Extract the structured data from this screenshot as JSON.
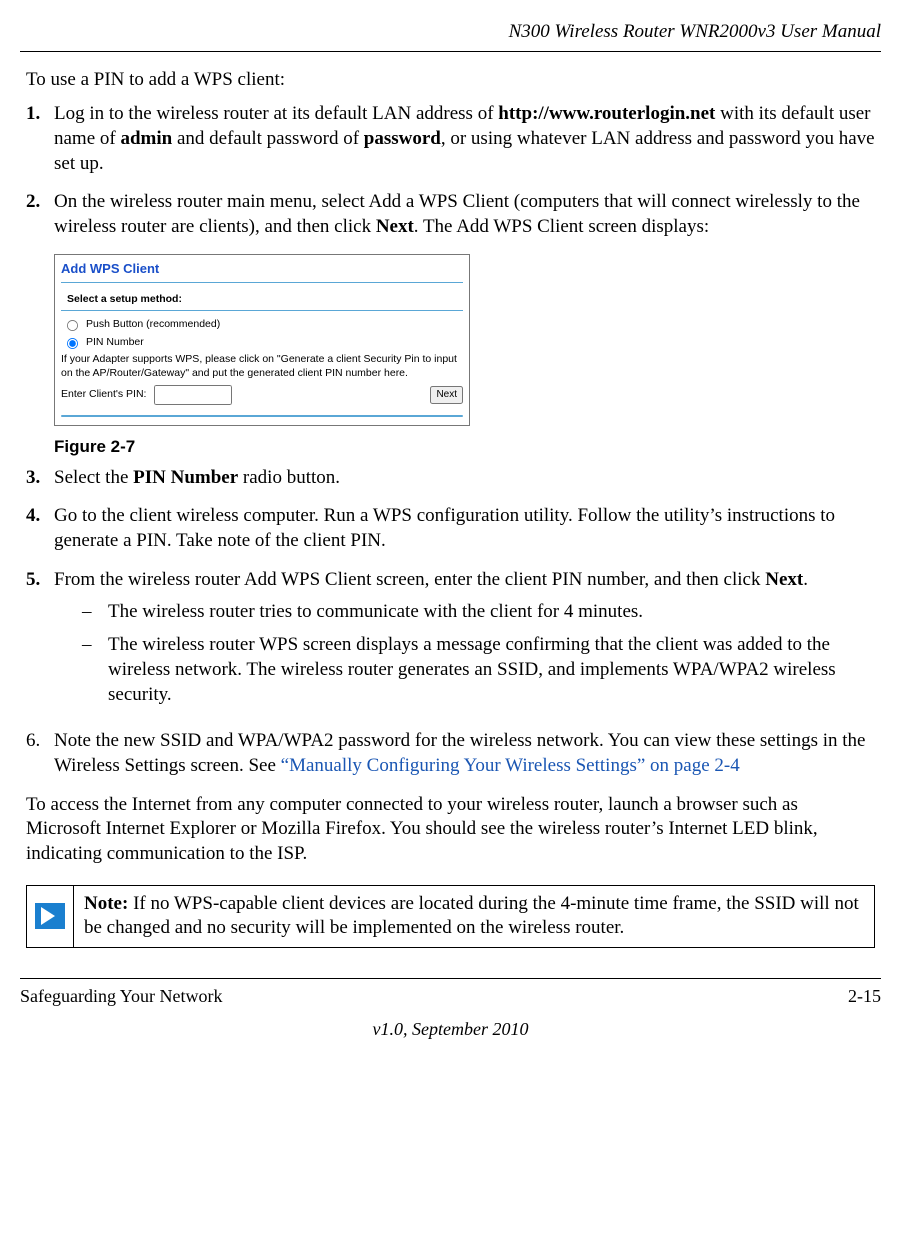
{
  "header": {
    "title": "N300 Wireless Router WNR2000v3 User Manual"
  },
  "intro": "To use a PIN to add a WPS client:",
  "steps": {
    "s1": {
      "num": "1.",
      "t1": "Log in to the wireless router at its default LAN address of ",
      "url": "http://www.routerlogin.net",
      "t2": " with its default user name of ",
      "admin": "admin",
      "t3": " and default password of ",
      "pwd": "password",
      "t4": ", or using whatever LAN address and password you have set up."
    },
    "s2": {
      "num": "2.",
      "t1": "On the wireless router main menu, select Add a WPS Client (computers that will connect wirelessly to the wireless router are clients), and then click ",
      "next": "Next",
      "t2": ". The Add WPS Client screen displays:"
    },
    "s3": {
      "num": "3.",
      "t1": "Select the ",
      "pin": "PIN Number",
      "t2": " radio button."
    },
    "s4": {
      "num": "4.",
      "text": "Go to the client wireless computer. Run a WPS configuration utility. Follow the utility’s instructions to generate a PIN. Take note of the client PIN."
    },
    "s5": {
      "num": "5.",
      "t1": "From the wireless router Add WPS Client screen, enter the client PIN number, and then click ",
      "next": "Next",
      "t2": ".",
      "d1": "The wireless router tries to communicate with the client for 4 minutes.",
      "d2": "The wireless router WPS screen displays a message confirming that the client was added to the wireless network. The wireless router generates an SSID, and implements WPA/WPA2 wireless security."
    },
    "s6": {
      "num": "6.",
      "t1": "Note the new SSID and WPA/WPA2 password for the wireless network. You can view these settings in the Wireless Settings screen. See ",
      "link": "“Manually Configuring Your Wireless Settings” on page 2-4"
    }
  },
  "fig": {
    "title": "Add WPS Client",
    "sub": "Select a setup method:",
    "opt1": "Push Button (recommended)",
    "opt2": "PIN Number",
    "note": "If your Adapter supports WPS, please click on \"Generate a client Security Pin to input on the AP/Router/Gateway\" and put the generated client PIN number here.",
    "enter": "Enter Client's PIN:",
    "nextBtn": "Next",
    "caption": "Figure 2-7"
  },
  "closing": "To access the Internet from any computer connected to your wireless router, launch a browser such as Microsoft Internet Explorer or Mozilla Firefox. You should see the wireless router’s Internet LED blink, indicating communication to the ISP.",
  "note": {
    "label": "Note:",
    "text": " If no WPS-capable client devices are located during the 4-minute time frame, the SSID will not be changed and no security will be implemented on the wireless router."
  },
  "footer": {
    "left": "Safeguarding Your Network",
    "right": "2-15",
    "version": "v1.0, September 2010"
  }
}
